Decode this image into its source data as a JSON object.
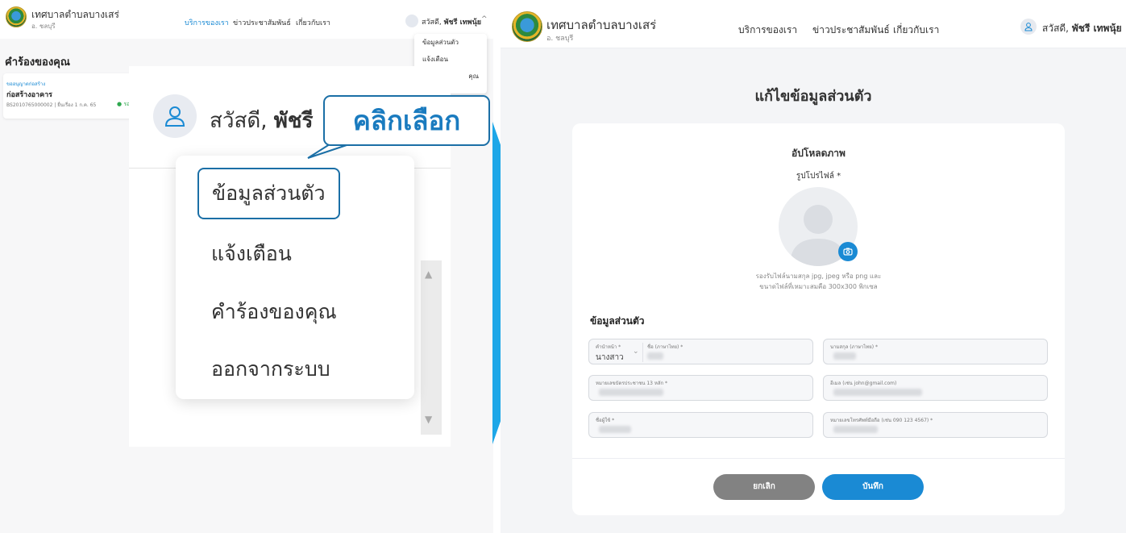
{
  "org": {
    "name": "เทศบาลตำบลบางเสร่",
    "district": "อ. ชลบุรี"
  },
  "nav": {
    "services": "บริการของเรา",
    "news": "ข่าวประชาสัมพันธ์",
    "about": "เกี่ยวกับเรา"
  },
  "user": {
    "greeting": "สวัสดี,",
    "name": "พัชรี เทพนุ้ย",
    "name_short": "พัชรี"
  },
  "small_menu": {
    "profile": "ข้อมูลส่วนตัว",
    "notifications": "แจ้งเตือน",
    "requests_partial": "คุณ"
  },
  "requests": {
    "title": "คำร้องของคุณ",
    "card": {
      "category": "ขออนุญาตก่อสร้าง",
      "title": "ก่อสร้างอาคาร",
      "meta": "BS2010765000002 | ยื่นเรื่อง 1 ก.ค. 65",
      "status": "● รอ"
    }
  },
  "menu": {
    "profile": "ข้อมูลส่วนตัว",
    "notifications": "แจ้งเตือน",
    "requests": "คำร้องของคุณ",
    "logout": "ออกจากระบบ"
  },
  "callout": "คลิกเลือก",
  "form": {
    "page_title": "แก้ไขข้อมูลส่วนตัว",
    "upload_title": "อัปโหลดภาพ",
    "profile_label": "รูปโปรไฟล์ *",
    "upload_hint_1": "รองรับไฟล์นามสกุล jpg, jpeg หรือ png และ",
    "upload_hint_2": "ขนาดไฟล์ที่เหมาะสมคือ 300x300 พิกเซล",
    "section_title": "ข้อมูลส่วนตัว",
    "prefix_label": "คำนำหน้า *",
    "prefix_value": "นางสาว",
    "firstname_label": "ชื่อ (ภาษาไทย) *",
    "lastname_label": "นามสกุล (ภาษาไทย) *",
    "idcard_label": "หมายเลขบัตรประชาชน 13 หลัก *",
    "email_label": "อีเมล (เช่น john@gmail.com)",
    "username_label": "ชื่อผู้ใช้ *",
    "phone_label": "หมายเลขโทรศัพท์มือถือ (เช่น 090 123 4567) *",
    "cancel": "ยกเลิก",
    "save": "บันทึก"
  },
  "colors": {
    "accent": "#1a8ad4",
    "callout_border": "#1b6fa6",
    "arrow": "#1da7e8",
    "cancel": "#828282"
  }
}
